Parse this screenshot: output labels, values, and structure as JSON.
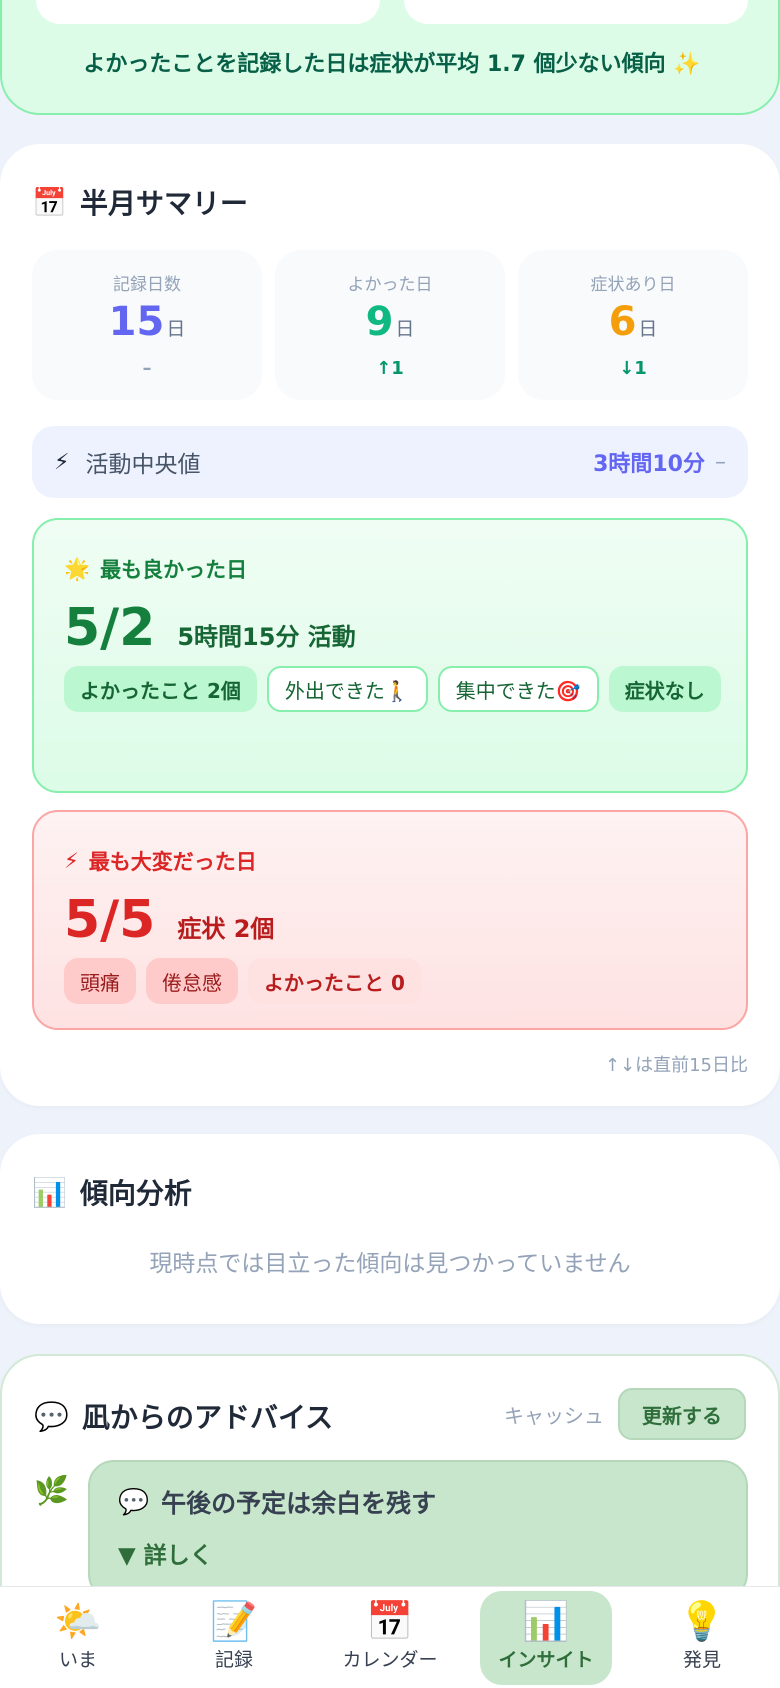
{
  "top": {
    "note": "よかったことを記録した日は症状が平均 1.7 個少ない傾向 ✨"
  },
  "summary": {
    "icon": "📅",
    "title": "半月サマリー",
    "stats": [
      {
        "label": "記録日数",
        "value": "15",
        "unit": "日",
        "change": "–",
        "color": "#6366f1",
        "change_color": "#94a3b8"
      },
      {
        "label": "よかった日",
        "value": "9",
        "unit": "日",
        "change": "↑1",
        "color": "#10b981",
        "change_color": "#059669"
      },
      {
        "label": "症状あり日",
        "value": "6",
        "unit": "日",
        "change": "↓1",
        "color": "#f59e0b",
        "change_color": "#059669"
      }
    ],
    "median": {
      "icon": "⚡",
      "label": "活動中央値",
      "value": "3時間10分",
      "change": "–"
    },
    "best": {
      "icon": "🌟",
      "label": "最も良かった日",
      "date": "5/2",
      "sub": "5時間15分 活動",
      "tags": [
        "よかったこと 2個",
        "外出できた🚶",
        "集中できた🎯",
        "症状なし"
      ]
    },
    "worst": {
      "icon": "⚡",
      "label": "最も大変だった日",
      "date": "5/5",
      "sub": "症状 2個",
      "tags": [
        "頭痛",
        "倦怠感",
        "よかったこと 0"
      ]
    },
    "footnote": "↑↓は直前15日比"
  },
  "trend": {
    "icon": "📊",
    "title": "傾向分析",
    "empty": "現時点では目立った傾向は見つかっていません"
  },
  "advice": {
    "icon": "💬",
    "title": "凪からのアドバイス",
    "cache_label": "キャッシュ",
    "refresh_label": "更新する",
    "leaf_icon": "🌿",
    "item_icon": "💬",
    "item_title": "午後の予定は余白を残す",
    "more": "▼ 詳しく"
  },
  "nav": [
    {
      "icon": "🌤️",
      "label": "いま",
      "active": false
    },
    {
      "icon": "📝",
      "label": "記録",
      "active": false
    },
    {
      "icon": "📅",
      "label": "カレンダー",
      "active": false
    },
    {
      "icon": "📊",
      "label": "インサイト",
      "active": true
    },
    {
      "icon": "💡",
      "label": "発見",
      "active": false
    }
  ],
  "colors": {
    "accent": "#6366f1",
    "good": "#15803d",
    "bad": "#dc2626",
    "advice": "#c8e6cc"
  }
}
